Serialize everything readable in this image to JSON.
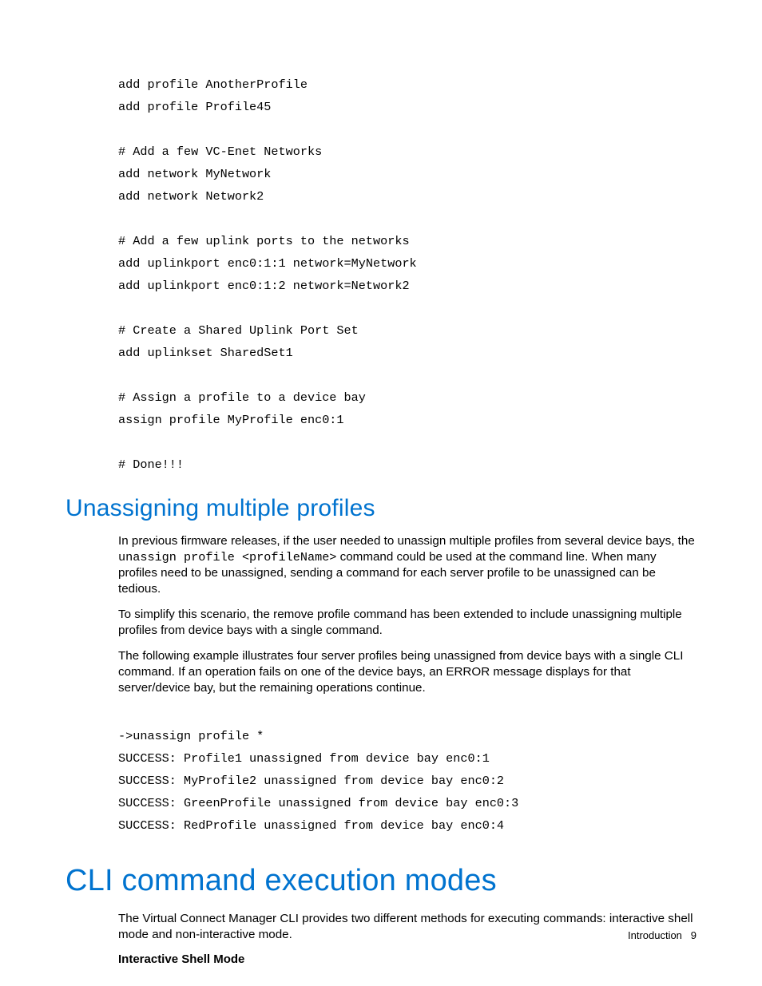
{
  "code1": {
    "l1": "add profile AnotherProfile",
    "l2": "add profile Profile45",
    "l3": "",
    "l4": "# Add a few VC-Enet Networks",
    "l5": "add network MyNetwork",
    "l6": "add network Network2",
    "l7": "",
    "l8": "# Add a few uplink ports to the networks",
    "l9": "add uplinkport enc0:1:1 network=MyNetwork",
    "l10": "add uplinkport enc0:1:2 network=Network2",
    "l11": "",
    "l12": "# Create a Shared Uplink Port Set",
    "l13": "add uplinkset SharedSet1",
    "l14": "",
    "l15": "# Assign a profile to a device bay",
    "l16": "assign profile MyProfile enc0:1",
    "l17": "",
    "l18": "# Done!!!"
  },
  "section1": {
    "heading": "Unassigning multiple profiles",
    "p1a": "In previous firmware releases, if the user needed to unassign multiple profiles from several device bays, the ",
    "p1_code": "unassign profile <profileName>",
    "p1b": " command could be used at the command line. When many profiles need to be unassigned, sending a command for each server profile to be unassigned can be tedious.",
    "p2": "To simplify this scenario, the remove profile command has been extended to include unassigning multiple profiles from device bays with a single command.",
    "p3": "The following example illustrates four server profiles being unassigned from device bays with a single CLI command. If an operation fails on one of the device bays, an ERROR message displays for that server/device bay, but the remaining operations continue."
  },
  "code2": {
    "l1": "->unassign profile *",
    "l2": "SUCCESS: Profile1 unassigned from device bay enc0:1",
    "l3": "SUCCESS: MyProfile2 unassigned from device bay enc0:2",
    "l4": "SUCCESS: GreenProfile unassigned from device bay enc0:3",
    "l5": "SUCCESS: RedProfile unassigned from device bay enc0:4"
  },
  "section2": {
    "heading": "CLI command execution modes",
    "p1": "The Virtual Connect Manager CLI provides two different methods for executing commands: interactive shell mode and non-interactive mode.",
    "sub": "Interactive Shell Mode"
  },
  "footer": {
    "label": "Introduction",
    "page": "9"
  }
}
